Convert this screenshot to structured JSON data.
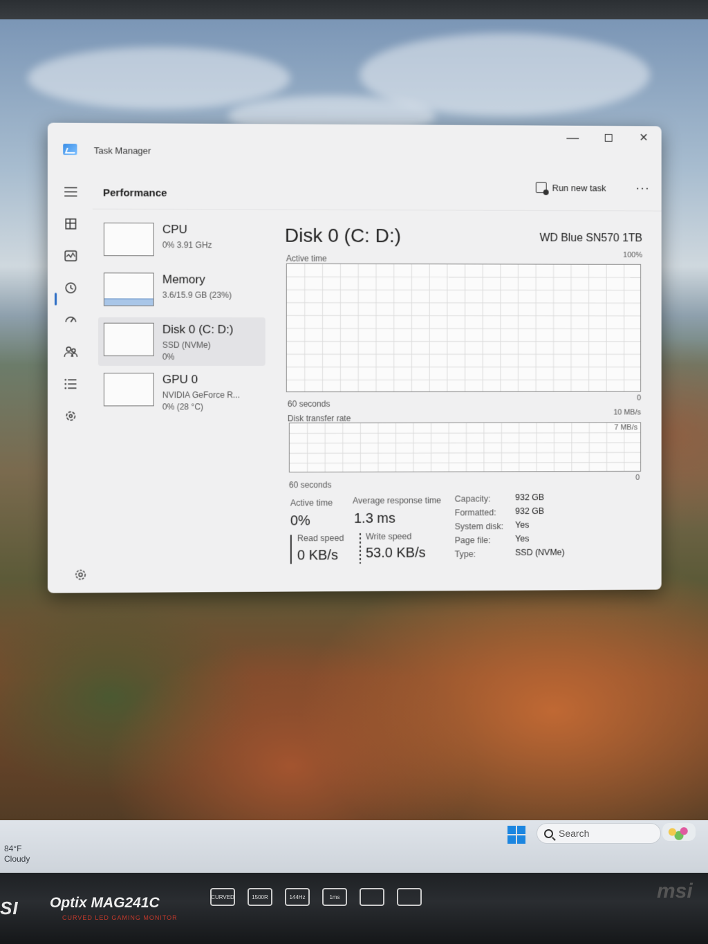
{
  "taskbar": {
    "weather_temp": "84°F",
    "weather_desc": "Cloudy",
    "search_label": "Search"
  },
  "monitor": {
    "brand": "SI",
    "model": "Optix MAG241C",
    "model_sub": "CURVED LED GAMING MONITOR",
    "spec_badges": [
      "CURVED",
      "1500R",
      "144Hz",
      "1ms",
      "",
      ""
    ]
  },
  "window": {
    "title": "Task Manager",
    "controls": {
      "minimize": "—",
      "close": "✕"
    }
  },
  "header": {
    "page_title": "Performance",
    "run_new_task": "Run new task",
    "more": "···"
  },
  "nav_icons": [
    "hamburger-icon",
    "processes-icon",
    "performance-icon",
    "app-history-icon",
    "startup-apps-icon",
    "users-icon",
    "details-icon",
    "services-icon",
    "settings-icon"
  ],
  "devices": [
    {
      "name": "CPU",
      "sub1": "0% 3.91 GHz",
      "sub2": "",
      "sub3": ""
    },
    {
      "name": "Memory",
      "sub1": "3.6/15.9 GB (23%)",
      "sub2": "",
      "sub3": ""
    },
    {
      "name": "Disk 0 (C: D:)",
      "sub1": "SSD (NVMe)",
      "sub2": "0%",
      "sub3": ""
    },
    {
      "name": "GPU 0",
      "sub1": "NVIDIA GeForce R...",
      "sub2": "0% (28 °C)",
      "sub3": ""
    }
  ],
  "detail": {
    "title": "Disk 0 (C: D:)",
    "model": "WD Blue SN570 1TB",
    "active_time_graph": {
      "label": "Active time",
      "max_label": "100%",
      "time_label": "60 seconds",
      "min_label": "0"
    },
    "transfer_graph": {
      "label": "Disk transfer rate",
      "max_label": "10 MB/s",
      "inner_label": "7 MB/s",
      "time_label": "60 seconds",
      "min_label": "0"
    },
    "stats": {
      "active_time_label": "Active time",
      "active_time_value": "0%",
      "avg_response_label": "Average response time",
      "avg_response_value": "1.3 ms",
      "read_speed_label": "Read speed",
      "read_speed_value": "0 KB/s",
      "write_speed_label": "Write speed",
      "write_speed_value": "53.0 KB/s"
    },
    "properties": [
      {
        "label": "Capacity:",
        "value": "932 GB"
      },
      {
        "label": "Formatted:",
        "value": "932 GB"
      },
      {
        "label": "System disk:",
        "value": "Yes"
      },
      {
        "label": "Page file:",
        "value": "Yes"
      },
      {
        "label": "Type:",
        "value": "SSD (NVMe)"
      }
    ]
  },
  "colors": {
    "accent": "#2b6cc4",
    "graph_line": "#7a7a7a",
    "memory_fill": "#a9c6e8"
  }
}
